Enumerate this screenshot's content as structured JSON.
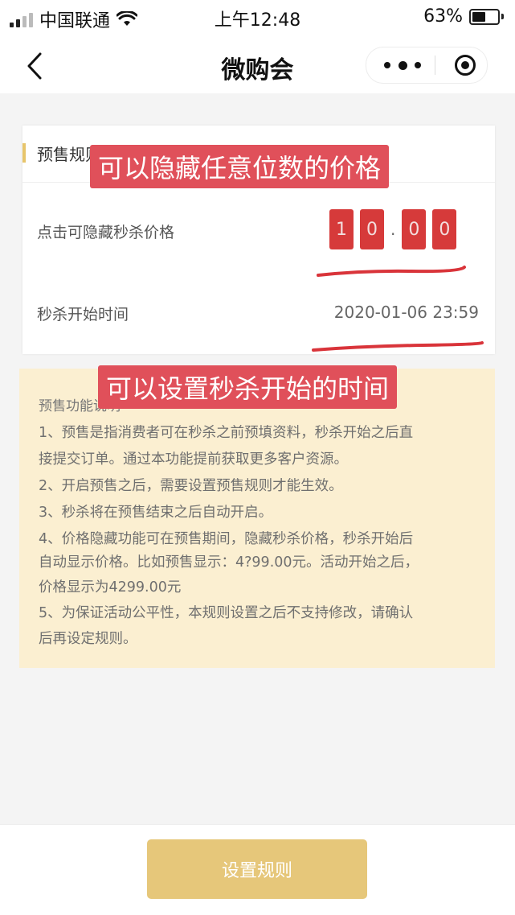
{
  "status_bar": {
    "carrier": "中国联通",
    "time": "上午12:48",
    "battery_percent": "63%",
    "battery_level": 0.63,
    "signal_bars": 2
  },
  "nav": {
    "title": "微购会"
  },
  "card": {
    "title": "预售规则",
    "price_label": "点击可隐藏秒杀价格",
    "price_digits": [
      "1",
      "0",
      "0",
      "0"
    ],
    "price_separator": ".",
    "time_label": "秒杀开始时间",
    "time_value": "2020-01-06 23:59"
  },
  "info": {
    "title": "预售功能说明",
    "lines": [
      "1、预售是指消费者可在秒杀之前预填资料，秒杀开始之后直",
      "接提交订单。通过本功能提前获取更多客户资源。",
      "2、开启预售之后，需要设置预售规则才能生效。",
      "3、秒杀将在预售结束之后自动开启。",
      "4、价格隐藏功能可在预售期间，隐藏秒杀价格，秒杀开始后",
      "自动显示价格。比如预售显示：4?99.00元。活动开始之后，",
      "价格显示为4299.00元",
      "5、为保证活动公平性，本规则设置之后不支持修改，请确认",
      "后再设定规则。"
    ]
  },
  "button": {
    "label": "设置规则"
  },
  "annotations": {
    "price_note": "可以隐藏任意位数的价格",
    "time_note": "可以设置秒杀开始的时间"
  },
  "colors": {
    "accent_gold": "#e6c77a",
    "info_bg": "#fbefd1",
    "digit_red": "#d63a3a",
    "annotation_red": "#e0505a"
  }
}
